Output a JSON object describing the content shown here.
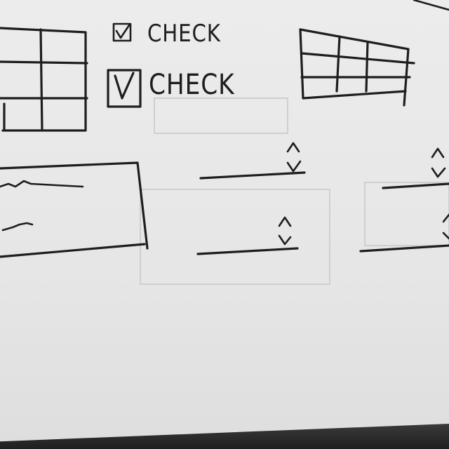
{
  "checkboxes": [
    {
      "label": "CHECK",
      "checked": true
    },
    {
      "label": "CHECK",
      "checked": true
    }
  ],
  "icons": {
    "spinner_up": "chevron-up-icon",
    "spinner_down": "chevron-down-icon",
    "checkmark": "checkmark-icon"
  },
  "colors": {
    "ink": "#1e1e1e",
    "paper": "#e9e9e9"
  }
}
